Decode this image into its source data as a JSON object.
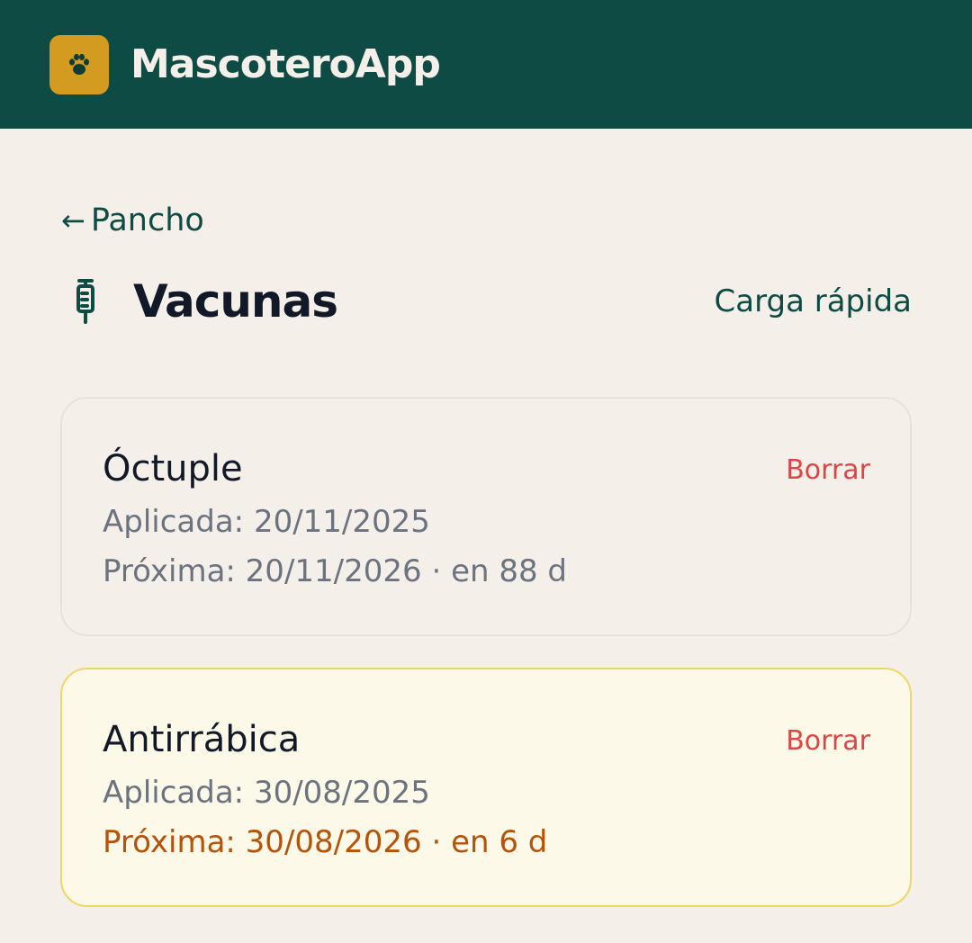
{
  "header": {
    "app_title": "MascoteroApp",
    "logo_icon": "paw-icon",
    "brand_color": "#0e4b45",
    "logo_color": "#d49b21"
  },
  "nav": {
    "back_arrow": "←",
    "back_label": "Pancho"
  },
  "page": {
    "title": "Vacunas",
    "title_icon": "syringe-icon",
    "quick_load_label": "Carga rápida"
  },
  "vaccines": [
    {
      "name": "Óctuple",
      "applied": "Aplicada: 20/11/2025",
      "next": "Próxima: 20/11/2026 · en 88 d",
      "delete_label": "Borrar",
      "highlight": false
    },
    {
      "name": "Antirrábica",
      "applied": "Aplicada: 30/08/2025",
      "next": "Próxima: 30/08/2026 · en 6 d",
      "delete_label": "Borrar",
      "highlight": true,
      "highlight_color": "#b4530a"
    }
  ]
}
